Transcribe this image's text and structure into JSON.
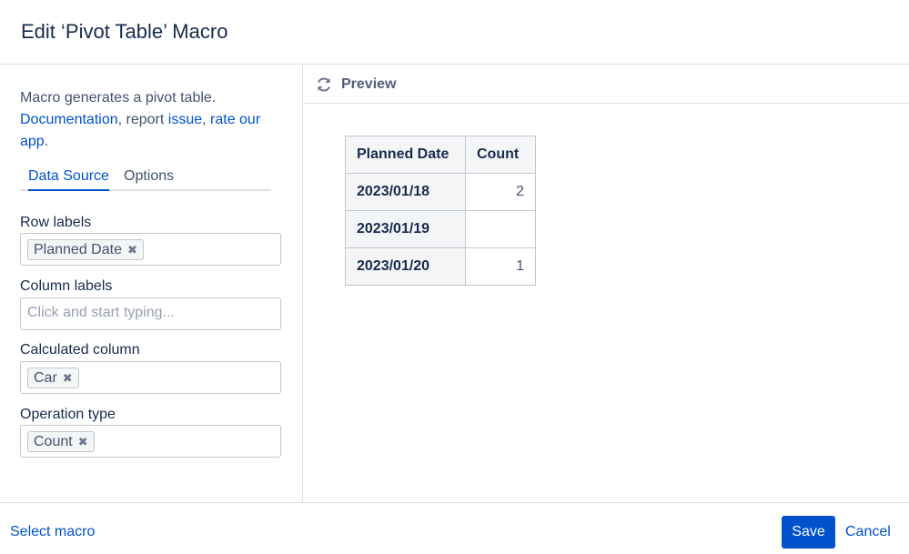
{
  "dialog": {
    "title": "Edit ‘Pivot Table’ Macro"
  },
  "sidebar": {
    "description": "Macro generates a pivot table.",
    "links": {
      "documentation": "Documentation",
      "sep1": ", report ",
      "issue": "issue",
      "sep2": ", ",
      "rate": "rate our app",
      "end": "."
    },
    "tabs": [
      {
        "label": "Data Source",
        "active": true
      },
      {
        "label": "Options",
        "active": false
      }
    ],
    "fields": {
      "row_labels": {
        "label": "Row labels",
        "chips": [
          "Planned Date"
        ]
      },
      "column_labels": {
        "label": "Column labels",
        "placeholder": "Click and start typing..."
      },
      "calculated_column": {
        "label": "Calculated column",
        "chips": [
          "Car"
        ]
      },
      "operation_type": {
        "label": "Operation type",
        "chips": [
          "Count"
        ]
      }
    }
  },
  "preview": {
    "label": "Preview",
    "icon": "refresh-icon",
    "table": {
      "headers": [
        "Planned Date",
        "Count"
      ],
      "rows": [
        {
          "date": "2023/01/18",
          "count": "2"
        },
        {
          "date": "2023/01/19",
          "count": ""
        },
        {
          "date": "2023/01/20",
          "count": "1"
        }
      ]
    }
  },
  "footer": {
    "select_macro": "Select macro",
    "save": "Save",
    "cancel": "Cancel"
  },
  "colors": {
    "accent": "#0052cc",
    "text": "#172b4d",
    "border": "#c1c7d0"
  }
}
